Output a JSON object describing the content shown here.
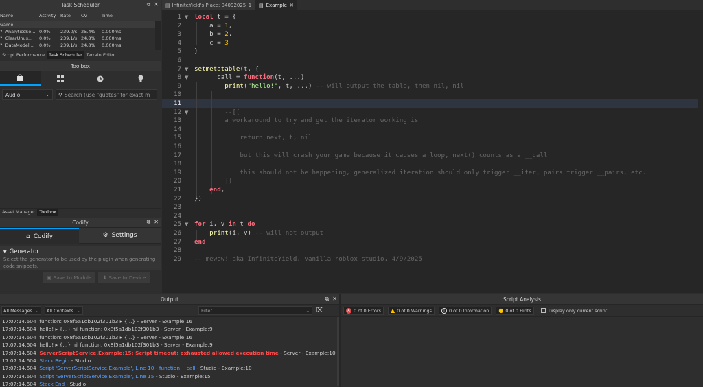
{
  "task_scheduler": {
    "title": "Task Scheduler",
    "columns": [
      "Name",
      "Activity",
      "Rate",
      "CV",
      "Time"
    ],
    "group": "Game",
    "rows": [
      {
        "name": "AnalyticsSe...",
        "activity": "0.0%",
        "rate": "239.0/s",
        "cv": "25.4%",
        "time": "0.000ms"
      },
      {
        "name": "ClearUnus...",
        "activity": "0.0%",
        "rate": "239.1/s",
        "cv": "24.8%",
        "time": "0.000ms"
      },
      {
        "name": "DataModel...",
        "activity": "0.0%",
        "rate": "239.1/s",
        "cv": "24.8%",
        "time": "0.000ms"
      }
    ],
    "tabs": [
      "Script Performance",
      "Task Scheduler",
      "Terrain Editor"
    ]
  },
  "toolbox": {
    "title": "Toolbox",
    "category": "Audio",
    "search_placeholder": "Search (use \"quotes\" for exact m",
    "tabs": [
      "Asset Manager",
      "Toolbox"
    ]
  },
  "codify": {
    "title": "Codify",
    "tab_codify": "Codify",
    "tab_settings": "Settings",
    "section": "Generator",
    "description": "Select the generator to be used by the plugin when generating code snippets.",
    "btn_save_module": "Save to Module",
    "btn_save_device": "Save to Device"
  },
  "editor_tabs": [
    {
      "label": "InfiniteYield's Place: 04092025_1"
    },
    {
      "label": "Example"
    }
  ],
  "code": {
    "current_line": 11,
    "line_numbers": [
      "1",
      "2",
      "3",
      "4",
      "5",
      "6",
      "7",
      "8",
      "9",
      "10",
      "11",
      "12",
      "13",
      "14",
      "15",
      "16",
      "17",
      "18",
      "19",
      "20",
      "21",
      "22",
      "23",
      "24",
      "25",
      "26",
      "27",
      "28",
      "29"
    ]
  },
  "output": {
    "title": "Output",
    "filter_messages": "All Messages",
    "filter_contexts": "All Contexts",
    "filter_placeholder": "Filter...",
    "lines": [
      {
        "ts": "17:07:14.604",
        "msg": "function: 0x8f5a1db102f301b3",
        "extra": "▸ {...}",
        "src": " -  Server - Example:16",
        "kind": "normal"
      },
      {
        "ts": "17:07:14.604",
        "msg": "hello!",
        "extra": "▸ {...} nil function: 0x8f5a1db102f301b3",
        "src": " -  Server - Example:9",
        "kind": "normal"
      },
      {
        "ts": "17:07:14.604",
        "msg": "function: 0x8f5a1db102f301b3",
        "extra": "▸ {...}",
        "src": " -  Server - Example:16",
        "kind": "normal"
      },
      {
        "ts": "17:07:14.604",
        "msg": "hello!",
        "extra": "▸ {...} nil function: 0x8f5a1db102f301b3",
        "src": " -  Server - Example:9",
        "kind": "normal"
      },
      {
        "ts": "17:07:14.604",
        "msg": "ServerScriptService.Example:15: Script timeout: exhausted allowed execution time",
        "extra": "",
        "src": " -  Server - Example:10",
        "kind": "error"
      },
      {
        "ts": "17:07:14.604",
        "msg": "Stack Begin",
        "extra": "",
        "src": " -  Studio",
        "kind": "blue"
      },
      {
        "ts": "17:07:14.604",
        "msg": "Script 'ServerScriptService.Example', Line 10 - function __call",
        "extra": "",
        "src": " -  Studio - Example:10",
        "kind": "blue"
      },
      {
        "ts": "17:07:14.604",
        "msg": "Script 'ServerScriptService.Example', Line 15",
        "extra": "",
        "src": " -  Studio - Example:15",
        "kind": "blue"
      },
      {
        "ts": "17:07:14.604",
        "msg": "Stack End",
        "extra": "",
        "src": " -  Studio",
        "kind": "blue"
      }
    ]
  },
  "script_analysis": {
    "title": "Script Analysis",
    "errors": "0 of 0 Errors",
    "warnings": "0 of 0 Warnings",
    "information": "0 of 0 Information",
    "hints": "0 of 0 Hints",
    "current_only": "Display only current script"
  },
  "colors": {
    "accent": "#00a2ff",
    "keyword": "#f86d7c",
    "number": "#ffc600",
    "string": "#adf195",
    "comment": "#666666",
    "error": "#ff4a4a",
    "stack": "#5aa0ff"
  }
}
